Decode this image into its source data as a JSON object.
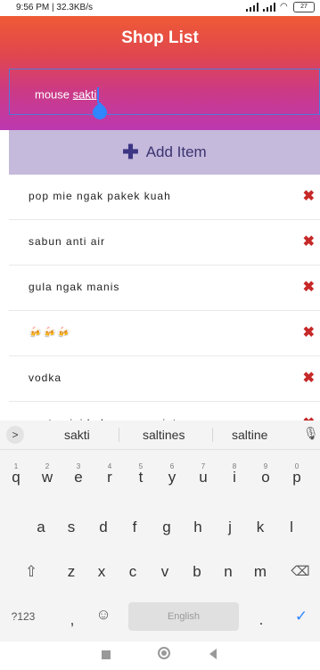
{
  "status_bar": {
    "left_text": "9:56 PM | 32.3KB/s",
    "battery": "27"
  },
  "app": {
    "title": "Shop List"
  },
  "input": {
    "value_plain": "mouse ",
    "value_underlined": "sakti"
  },
  "add_button": {
    "label": "Add Item",
    "icon": "plus-icon"
  },
  "items": [
    {
      "text": "pop mie ngak pakek kuah"
    },
    {
      "text": "sabun anti air"
    },
    {
      "text": "gula ngak manis"
    },
    {
      "text": "🍻🍻🍻"
    },
    {
      "text": "vodka"
    },
    {
      "text": "pasta gigi bukan rasa mint"
    }
  ],
  "keyboard": {
    "suggestions": [
      "sakti",
      "saltines",
      "saltine"
    ],
    "row1": [
      "q",
      "w",
      "e",
      "r",
      "t",
      "y",
      "u",
      "i",
      "o",
      "p"
    ],
    "row1_digits": [
      "1",
      "2",
      "3",
      "4",
      "5",
      "6",
      "7",
      "8",
      "9",
      "0"
    ],
    "row2": [
      "a",
      "s",
      "d",
      "f",
      "g",
      "h",
      "j",
      "k",
      "l"
    ],
    "row3": [
      "z",
      "x",
      "c",
      "v",
      "b",
      "n",
      "m"
    ],
    "symbols_label": "?123",
    "comma": ",",
    "period": ".",
    "space_label": "English"
  }
}
